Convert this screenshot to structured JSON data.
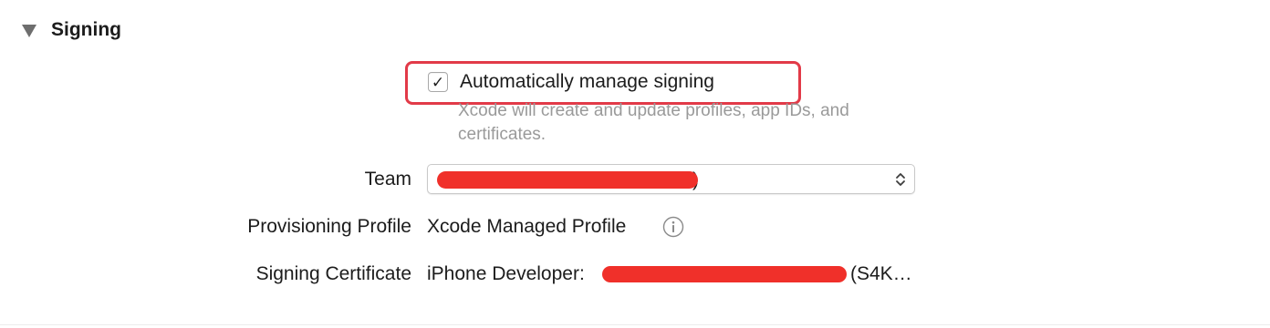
{
  "section": {
    "title": "Signing"
  },
  "auto_manage": {
    "label": "Automatically manage signing",
    "checked": true,
    "help_text": "Xcode will create and update profiles, app IDs, and certificates.",
    "highlight_color": "#e23a48"
  },
  "team": {
    "label": "Team",
    "value_visible_suffix": ")"
  },
  "provisioning_profile": {
    "label": "Provisioning Profile",
    "value": "Xcode Managed Profile",
    "icon": "info-icon"
  },
  "signing_certificate": {
    "label": "Signing Certificate",
    "value_prefix": "iPhone Developer:",
    "value_suffix": "(S4K…"
  },
  "colors": {
    "redaction": "#f0302a",
    "secondary_text": "#9a9a9a"
  }
}
